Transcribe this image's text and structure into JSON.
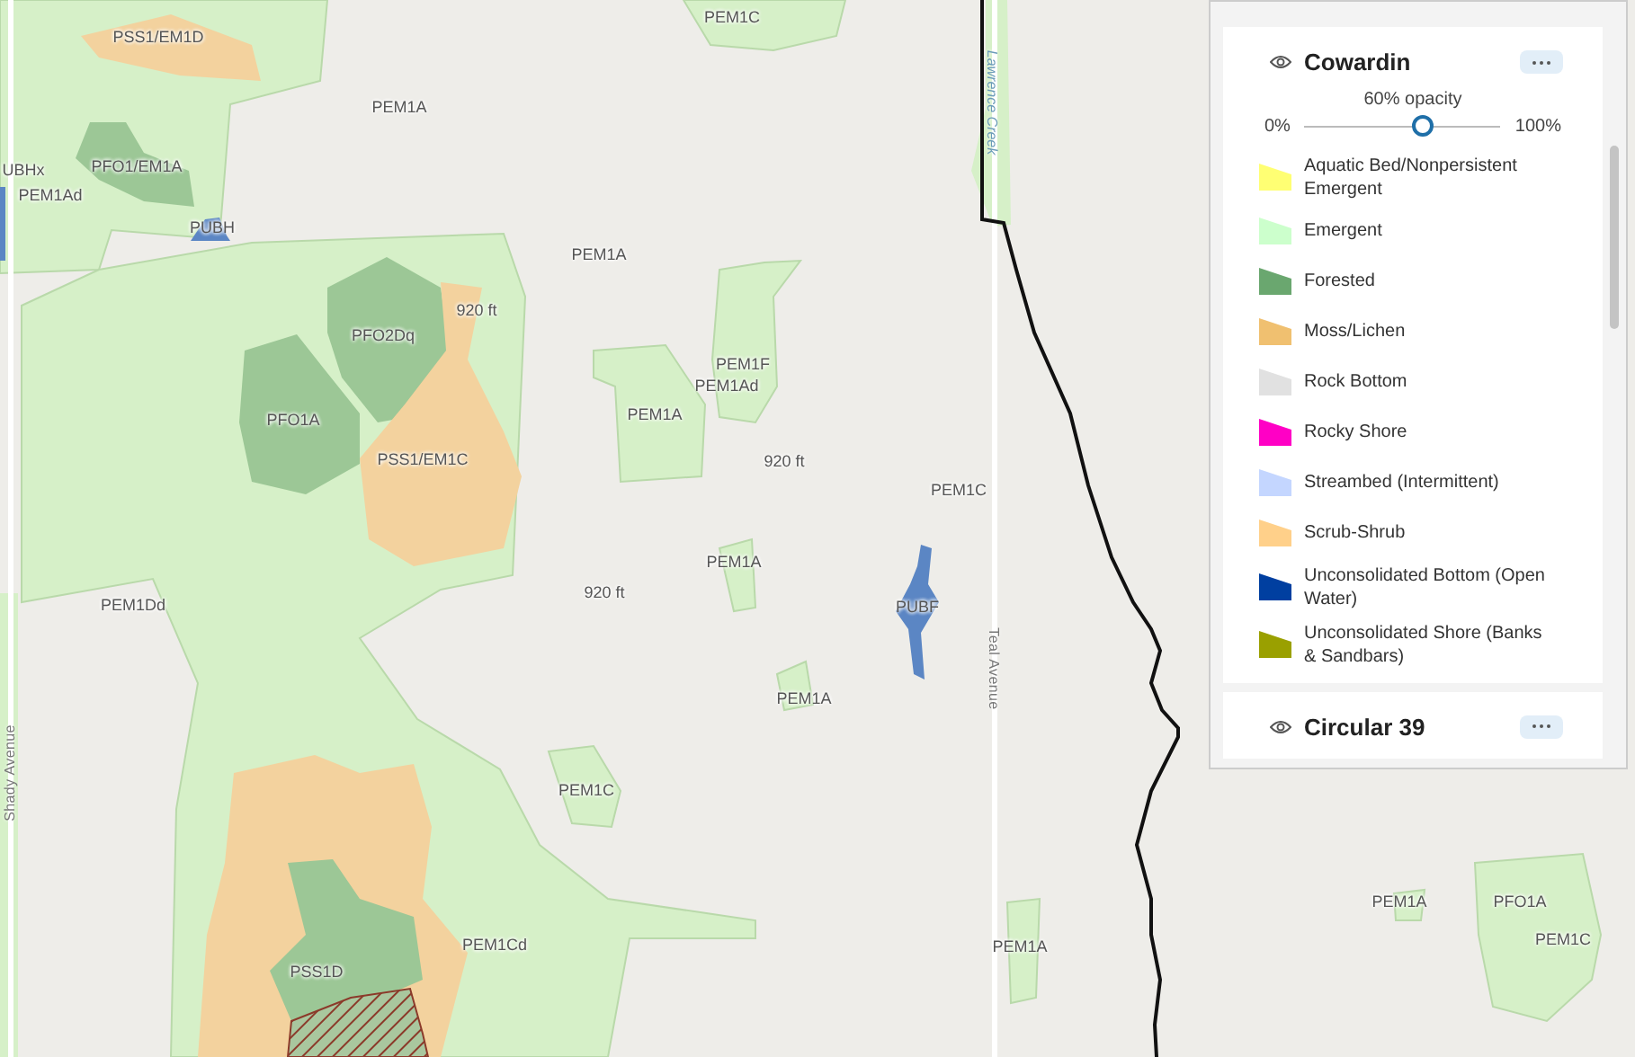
{
  "map": {
    "labels": [
      {
        "text": "PSS1/EM1D"
      },
      {
        "text": "PEM1C"
      },
      {
        "text": "PEM1A"
      },
      {
        "text": "PFO1/EM1A"
      },
      {
        "text": "UBHx"
      },
      {
        "text": "PEM1Ad"
      },
      {
        "text": "PUBH"
      },
      {
        "text": "PEM1A"
      },
      {
        "text": "920 ft"
      },
      {
        "text": "PFO2Dq"
      },
      {
        "text": "PEM1F"
      },
      {
        "text": "PEM1Ad"
      },
      {
        "text": "PFO1A"
      },
      {
        "text": "PEM1A"
      },
      {
        "text": "PSS1/EM1C"
      },
      {
        "text": "920 ft"
      },
      {
        "text": "PEM1C"
      },
      {
        "text": "PEM1Dd"
      },
      {
        "text": "920 ft"
      },
      {
        "text": "PEM1A"
      },
      {
        "text": "PUBF"
      },
      {
        "text": "PEM1A"
      },
      {
        "text": "PEM1C"
      },
      {
        "text": "PEM1Cd"
      },
      {
        "text": "PSS1D"
      },
      {
        "text": "PEM1A"
      },
      {
        "text": "PEM1A"
      },
      {
        "text": "PFO1A"
      },
      {
        "text": "PEM1C"
      }
    ],
    "road_labels": [
      {
        "text": "Lawrence Creek",
        "kind": "creek"
      },
      {
        "text": "Teal Avenue",
        "kind": "road"
      },
      {
        "text": "Shady Avenue",
        "kind": "road"
      }
    ]
  },
  "legend": {
    "layers": [
      {
        "title": "Cowardin",
        "opacity_label": "60% opacity",
        "min_label": "0%",
        "max_label": "100%",
        "level": 0.6,
        "items": [
          {
            "label": "Aquatic Bed/Nonpersistent Emergent",
            "color": "#ffff73"
          },
          {
            "label": "Emergent",
            "color": "#ccffcc"
          },
          {
            "label": "Forested",
            "color": "#6aa76f"
          },
          {
            "label": "Moss/Lichen",
            "color": "#f0c070"
          },
          {
            "label": "Rock Bottom",
            "color": "#e1e1e1"
          },
          {
            "label": "Rocky Shore",
            "color": "#ff00c5"
          },
          {
            "label": "Streambed (Intermittent)",
            "color": "#c4d6ff"
          },
          {
            "label": "Scrub-Shrub",
            "color": "#ffd08a"
          },
          {
            "label": "Unconsolidated Bottom (Open Water)",
            "color": "#003fa0"
          },
          {
            "label": "Unconsolidated Shore (Banks & Sandbars)",
            "color": "#9aa000"
          }
        ]
      },
      {
        "title": "Circular 39"
      }
    ]
  }
}
